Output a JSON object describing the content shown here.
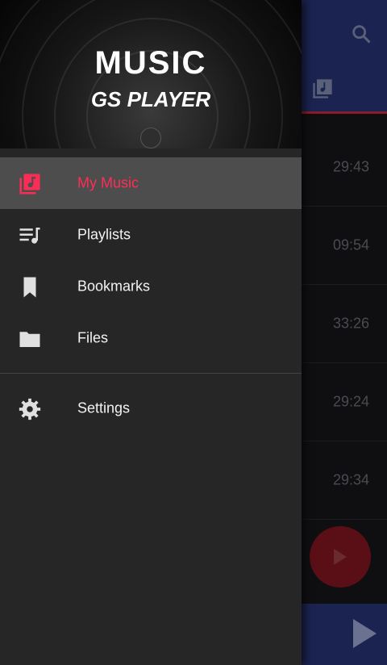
{
  "app": {
    "logo_title": "MUSIC",
    "logo_subtitle": "GS PLAYER"
  },
  "drawer": {
    "items": [
      {
        "label": "My Music",
        "icon": "music-library-icon",
        "active": true
      },
      {
        "label": "Playlists",
        "icon": "playlist-icon",
        "active": false
      },
      {
        "label": "Bookmarks",
        "icon": "bookmark-icon",
        "active": false
      },
      {
        "label": "Files",
        "icon": "folder-icon",
        "active": false
      }
    ],
    "settings": {
      "label": "Settings",
      "icon": "gear-icon"
    }
  },
  "background_list": {
    "durations": [
      "29:43",
      "09:54",
      "33:26",
      "29:24",
      "29:34"
    ]
  },
  "colors": {
    "accent": "#ff2d55",
    "toolbar": "#1b2350",
    "drawer_bg": "#262626",
    "active_row": "#4d4d4d"
  }
}
